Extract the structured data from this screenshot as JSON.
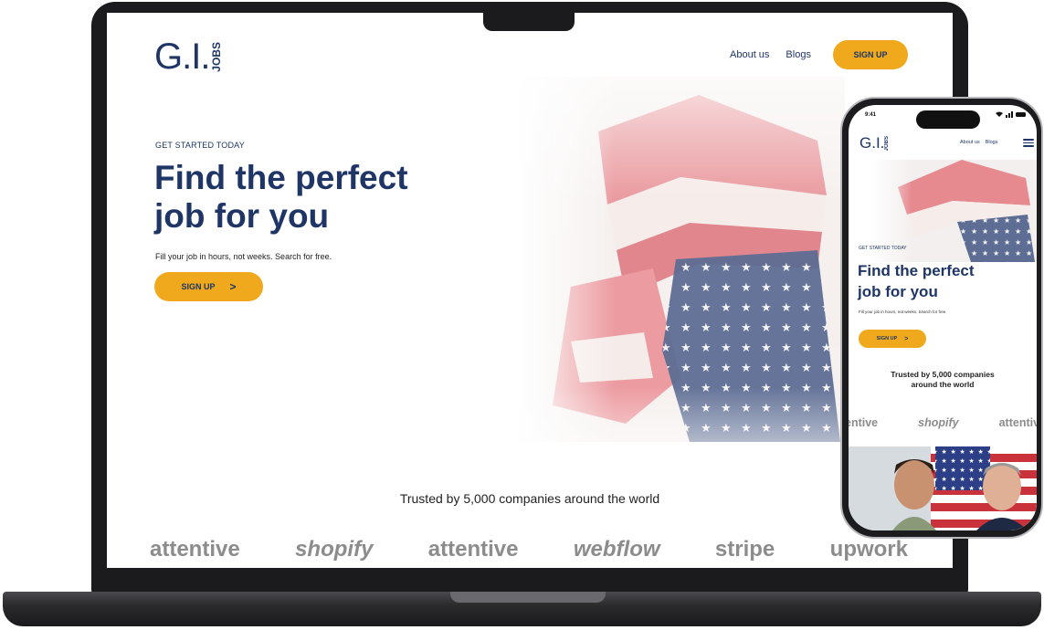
{
  "desktop": {
    "logo": {
      "text": "G.I.",
      "badge": "JOBS"
    },
    "nav": {
      "about": "About us",
      "blogs": "Blogs",
      "signup": "SIGN UP"
    },
    "hero": {
      "eyebrow": "GET STARTED TODAY",
      "title_line1": "Find the perfect",
      "title_line2": "job for you",
      "subtitle": "Fill your job in hours, not weeks. Search for free.",
      "cta": "SIGN UP",
      "cta_arrow": ">"
    },
    "trusted": "Trusted by 5,000 companies around the world",
    "partners": [
      "attentive",
      "shopify",
      "attentive",
      "webflow",
      "stripe",
      "upwork"
    ]
  },
  "mobile": {
    "time": "9:41",
    "status_icons": "wifi signal battery",
    "logo": {
      "text": "G.I.",
      "badge": "JOBS"
    },
    "nav": {
      "about": "About us",
      "blogs": "Blogs"
    },
    "hero": {
      "eyebrow": "GET STARTED TODAY",
      "title_line1": "Find the perfect",
      "title_line2": "job for you",
      "subtitle": "Fill your job in hours, not weeks. Search for free.",
      "cta": "SIGN UP",
      "cta_arrow": ">"
    },
    "trusted_line1": "Trusted by 5,000 companies",
    "trusted_line2": "around the world",
    "partners": [
      "entive",
      "shopify",
      "attentive"
    ]
  },
  "colors": {
    "navy": "#1e3566",
    "accent": "#f0a91c",
    "logo_gray": "#8c8c8c"
  }
}
